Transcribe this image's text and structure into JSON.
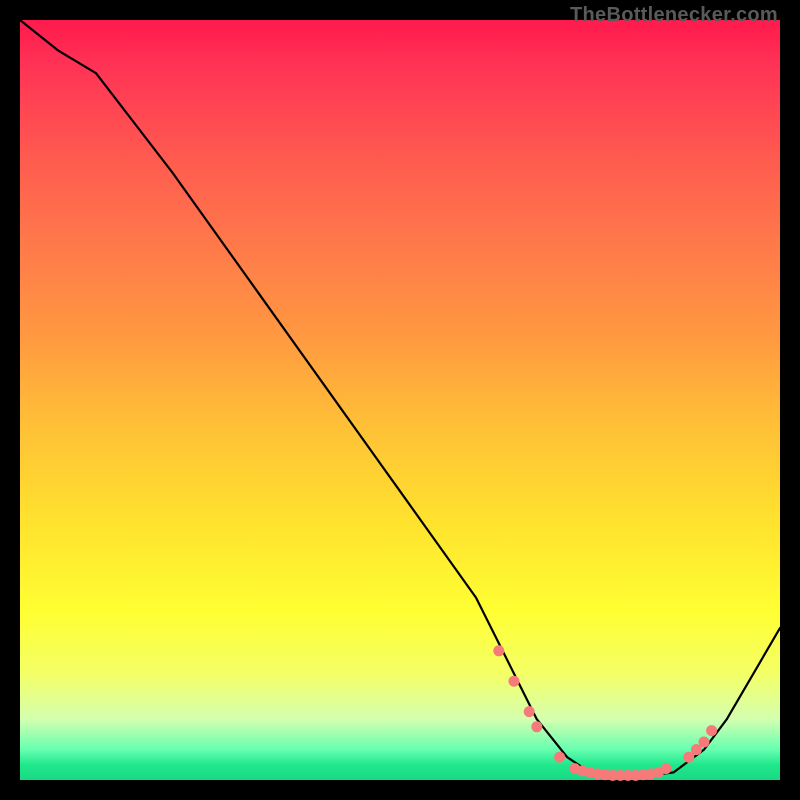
{
  "attribution": "TheBottlenecker.com",
  "chart_data": {
    "type": "line",
    "title": "",
    "xlabel": "",
    "ylabel": "",
    "xlim": [
      0,
      100
    ],
    "ylim": [
      0,
      100
    ],
    "series": [
      {
        "name": "bottleneck-curve",
        "x": [
          0,
          5,
          10,
          20,
          30,
          40,
          50,
          60,
          65,
          68,
          72,
          75,
          78,
          82,
          86,
          90,
          93,
          100
        ],
        "y": [
          100,
          96,
          93,
          80,
          66,
          52,
          38,
          24,
          14,
          8,
          3,
          1,
          0.5,
          0.5,
          1,
          4,
          8,
          20
        ]
      }
    ],
    "markers": {
      "name": "highlight-points",
      "x": [
        63,
        65,
        67,
        68,
        71,
        73,
        74,
        75,
        76,
        77,
        78,
        79,
        80,
        81,
        82,
        83,
        84,
        85,
        88,
        89,
        90,
        91
      ],
      "y": [
        17,
        13,
        9,
        7,
        3,
        1.5,
        1.2,
        1,
        0.8,
        0.7,
        0.6,
        0.6,
        0.6,
        0.6,
        0.7,
        0.8,
        1,
        1.5,
        3,
        4,
        5,
        6.5
      ]
    },
    "colors": {
      "gradient_top": "#ff1a4d",
      "gradient_bottom": "#18d884",
      "curve": "#000000",
      "marker": "#f77a7a",
      "frame": "#000000"
    }
  }
}
